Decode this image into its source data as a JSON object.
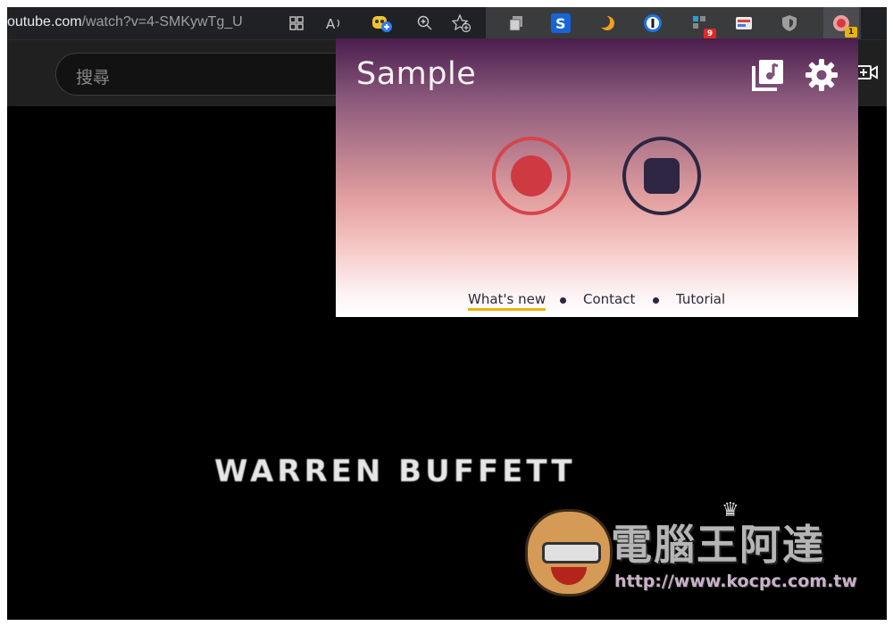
{
  "browser": {
    "url_host": "outube.com",
    "url_path": "/watch?v=4-SMKywTg_U",
    "extensions": [
      {
        "name": "ext-s-icon",
        "badge": ""
      },
      {
        "name": "ext-list-badge-icon",
        "badge": "9"
      },
      {
        "name": "ext-recorder-icon",
        "badge": "1"
      }
    ]
  },
  "masthead": {
    "search_placeholder": "搜尋"
  },
  "video": {
    "title_text": "WARREN BUFFETT"
  },
  "watermark": {
    "brand": "電腦王阿達",
    "url": "http://www.kocpc.com.tw"
  },
  "popup": {
    "title": "Sample",
    "footer_links": [
      {
        "label": "What's new",
        "active": true
      },
      {
        "label": "Contact",
        "active": false
      },
      {
        "label": "Tutorial",
        "active": false
      }
    ]
  },
  "colors": {
    "record": "#cf3a42",
    "stop": "#2e2643",
    "active_underline": "#eab30b",
    "badge_red": "#e02828",
    "badge_yellow": "#e8b40c"
  }
}
